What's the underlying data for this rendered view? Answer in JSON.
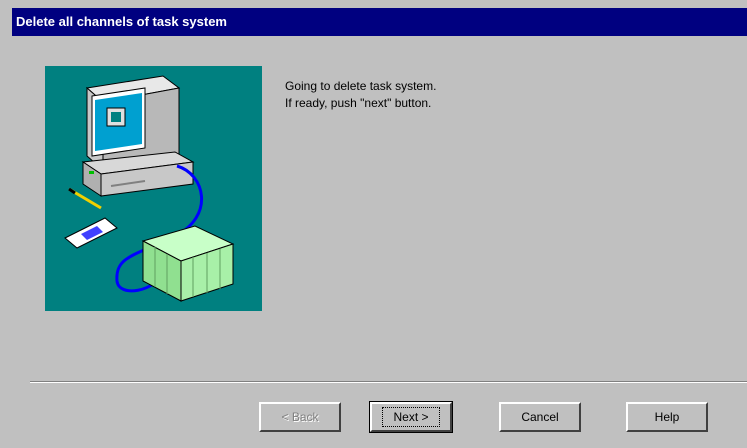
{
  "window": {
    "title": "Delete all channels of task system"
  },
  "message": {
    "line1": "Going to delete task system.",
    "line2": "If ready, push \"next\" button."
  },
  "buttons": {
    "back": "< Back",
    "next": "Next >",
    "cancel": "Cancel",
    "help": "Help"
  },
  "colors": {
    "titlebar": "#000080",
    "illustration_bg": "#008080",
    "dialog_bg": "#c0c0c0"
  }
}
